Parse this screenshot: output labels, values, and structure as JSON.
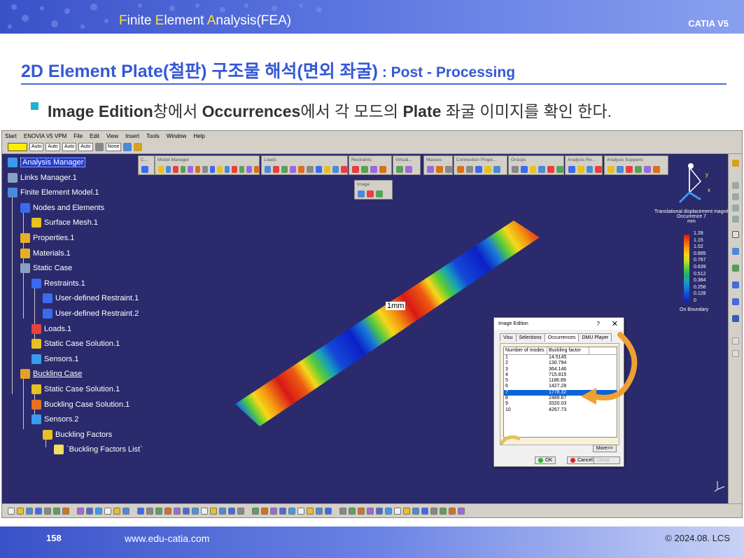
{
  "slide": {
    "header_parts": [
      {
        "t": "F",
        "hl": true
      },
      {
        "t": "inite ",
        "hl": false
      },
      {
        "t": "E",
        "hl": true
      },
      {
        "t": "lement ",
        "hl": false
      },
      {
        "t": "A",
        "hl": true
      },
      {
        "t": "nalysis(FEA)",
        "hl": false
      }
    ],
    "app_label": "CATIA V5",
    "title_main": "2D Element Plate(철판) 구조물 해석(면외 좌굴)",
    "title_sub": " : Post - Processing",
    "bullet_parts": [
      {
        "t": "Image Edition",
        "b": true
      },
      {
        "t": "창에서 ",
        "b": false
      },
      {
        "t": "Occurrences",
        "b": true
      },
      {
        "t": "에서 각 모드의 ",
        "b": false
      },
      {
        "t": "Plate",
        "b": true
      },
      {
        "t": " 좌굴 이미지를 확인 한다.",
        "b": false
      }
    ],
    "page_number": "158",
    "website": "www.edu-catia.com",
    "copyright": "© 2024.08. LCS"
  },
  "menubar": [
    "Start",
    "ENOVIA V5 VPM",
    "File",
    "Edit",
    "View",
    "Insert",
    "Tools",
    "Window",
    "Help"
  ],
  "toolbar": {
    "combo1": "Auto",
    "combo2": "Auto",
    "combo3": "Auto",
    "combo4": "None",
    "combo5": "Auto"
  },
  "tree": [
    {
      "label": "Analysis Manager",
      "selected": true,
      "icon": "analysis-icon"
    },
    {
      "label": "Links Manager.1",
      "icon": "links-icon"
    },
    {
      "label": "Finite Element Model.1",
      "icon": "fem-icon"
    },
    {
      "label": "Nodes and Elements",
      "icon": "nodes-icon"
    },
    {
      "label": "Surface Mesh.1",
      "icon": "mesh-icon"
    },
    {
      "label": "Properties.1",
      "icon": "folder-icon"
    },
    {
      "label": "Materials.1",
      "icon": "folder-icon"
    },
    {
      "label": "Static Case",
      "icon": "case-icon"
    },
    {
      "label": "Restraints.1",
      "icon": "restraint-icon"
    },
    {
      "label": "User-defined Restraint.1",
      "icon": "restraint-icon"
    },
    {
      "label": "User-defined Restraint.2",
      "icon": "restraint-icon"
    },
    {
      "label": "Loads.1",
      "icon": "load-icon"
    },
    {
      "label": "Static Case Solution.1",
      "icon": "solution-icon"
    },
    {
      "label": "Sensors.1",
      "icon": "sensor-icon"
    },
    {
      "label": "Buckling Case",
      "underline": true,
      "icon": "buckling-icon"
    },
    {
      "label": "Static Case Solution.1",
      "icon": "solution-icon"
    },
    {
      "label": "Buckling Case Solution.1",
      "icon": "solution-icon"
    },
    {
      "label": "Sensors.2",
      "icon": "sensor-icon"
    },
    {
      "label": "Buckling Factors",
      "icon": "factors-icon"
    },
    {
      "label": "`Buckling Factors List`",
      "icon": "list-icon"
    }
  ],
  "floating_toolbars": [
    "C...",
    "Model Manager",
    "Loads",
    "Restraints",
    "Virtual...",
    "Masses",
    "Connection Prope...",
    "Groups",
    "Analysis Re...",
    "Analysis Supports",
    "Image"
  ],
  "axis_labels": {
    "y": "y",
    "x": "x"
  },
  "legend": {
    "title": "Translational displacement magnit",
    "occurrence": "Occurrence 7",
    "unit": "mm",
    "values": [
      "1.28",
      "1.15",
      "1.02",
      "0.895",
      "0.767",
      "0.639",
      "0.512",
      "0.384",
      "0.256",
      "0.128",
      "0"
    ],
    "boundary": "On Boundary",
    "colors": [
      "#d81818",
      "#ee5a10",
      "#f59a10",
      "#f5d81a",
      "#c0e028",
      "#58cc38",
      "#22b070",
      "#18a0b8",
      "#1878d8",
      "#1448d8",
      "#0c20c8"
    ]
  },
  "mesh_label": "1mm",
  "dialog": {
    "title": "Image Edition",
    "help": "?",
    "close": "✕",
    "tabs": [
      "Visu",
      "Selections",
      "Occurrences",
      "DMU Player"
    ],
    "active_tab": 2,
    "columns": [
      "Number of modes",
      "Buckling factor"
    ],
    "rows": [
      [
        "1",
        "14.5145"
      ],
      [
        "2",
        "130.794"
      ],
      [
        "3",
        "364.146"
      ],
      [
        "4",
        "715.815"
      ],
      [
        "5",
        "1186.89"
      ],
      [
        "6",
        "1427.28"
      ],
      [
        "7",
        "1778.32"
      ],
      [
        "8",
        "2489.67"
      ],
      [
        "9",
        "3320.03"
      ],
      [
        "10",
        "4267.73"
      ]
    ],
    "selected_row": 6,
    "more": "More>>",
    "ok": "OK",
    "cancel": "Cancel",
    "close_btn": "Close"
  }
}
